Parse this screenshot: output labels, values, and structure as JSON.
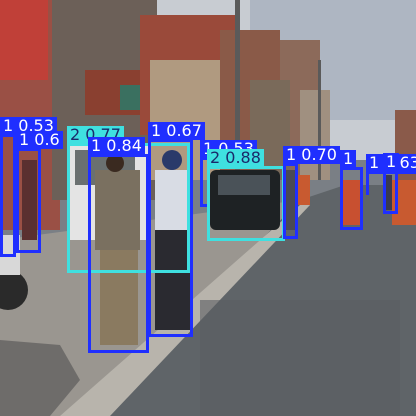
{
  "colors": {
    "person_box": "#1f2fff",
    "car_box": "#3fe0e0",
    "label_text_person": "#ffffff",
    "label_text_car": "#1a2a6a"
  },
  "detections": [
    {
      "cls_id": "1",
      "conf": "0.53",
      "kind": "person"
    },
    {
      "cls_id": "1",
      "conf": "0.6",
      "kind": "person"
    },
    {
      "cls_id": "2",
      "conf": "0.77",
      "kind": "car"
    },
    {
      "cls_id": "1",
      "conf": "0.67",
      "kind": "person"
    },
    {
      "cls_id": "1",
      "conf": "0.84",
      "kind": "person"
    },
    {
      "cls_id": "1",
      "conf": "0.53",
      "kind": "person"
    },
    {
      "cls_id": "2",
      "conf": "0.88",
      "kind": "car"
    },
    {
      "cls_id": "1",
      "conf": "0.70",
      "kind": "person"
    },
    {
      "cls_id": "1",
      "conf": "",
      "kind": "person"
    },
    {
      "cls_id": "1",
      "conf": "0.63",
      "kind": "person"
    },
    {
      "cls_id": "1",
      "conf": "",
      "kind": "person"
    }
  ]
}
